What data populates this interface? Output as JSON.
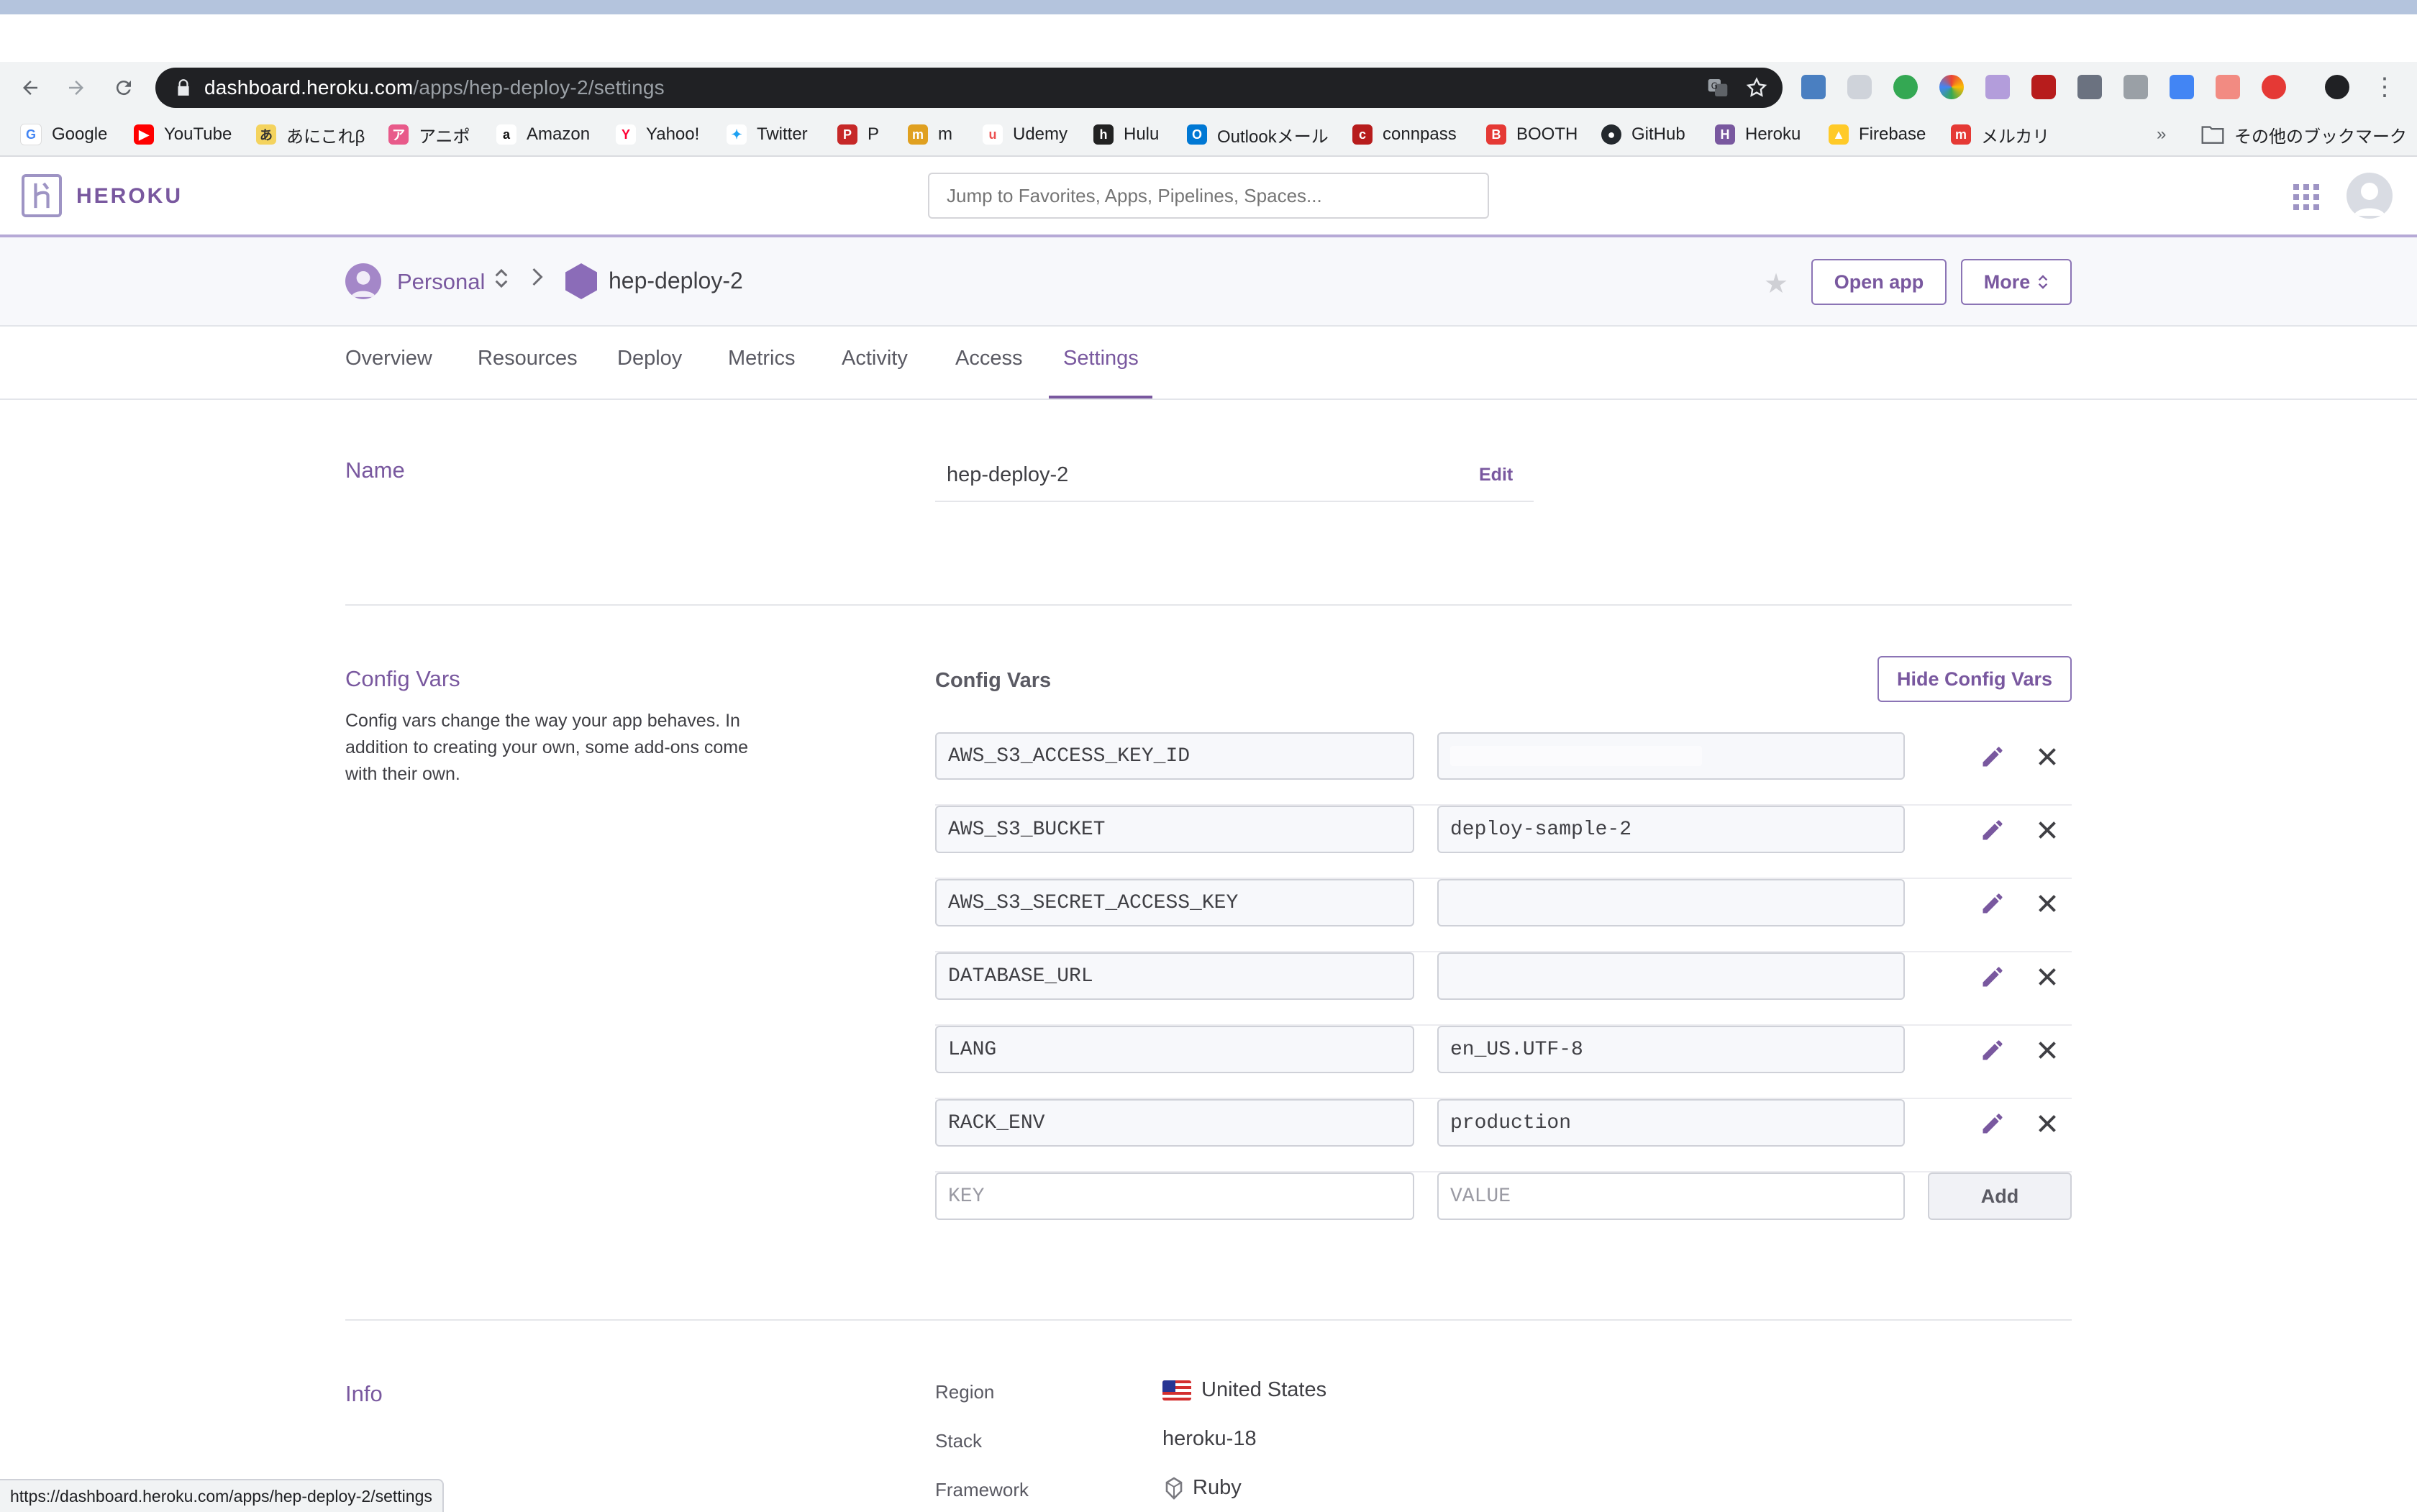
{
  "browser": {
    "url_host": "dashboard.heroku.com",
    "url_path": "/apps/hep-deploy-2/settings",
    "status_url": "https://dashboard.heroku.com/apps/hep-deploy-2/settings",
    "overflow_label": "»",
    "bookmarks": [
      {
        "label": "Google",
        "icon": "google-icon",
        "color": "#4285f4"
      },
      {
        "label": "YouTube",
        "icon": "youtube-icon",
        "color": "#ff0000"
      },
      {
        "label": "あにこれβ",
        "icon": "anikore-icon",
        "color": "#c9a227"
      },
      {
        "label": "アニポ",
        "icon": "anipo-icon",
        "color": "#e85a8a"
      },
      {
        "label": "Amazon",
        "icon": "amazon-icon",
        "color": "#111111"
      },
      {
        "label": "Yahoo!",
        "icon": "yahoo-icon",
        "color": "#ff0033"
      },
      {
        "label": "Twitter",
        "icon": "twitter-icon",
        "color": "#1da1f2"
      },
      {
        "label": "P",
        "icon": "p-icon",
        "color": "#c62828"
      },
      {
        "label": "m",
        "icon": "m-icon",
        "color": "#e0a020"
      },
      {
        "label": "Udemy",
        "icon": "udemy-icon",
        "color": "#ec5252"
      },
      {
        "label": "Hulu",
        "icon": "hulu-icon",
        "color": "#222222"
      },
      {
        "label": "Outlookメール",
        "icon": "outlook-icon",
        "color": "#0078d4"
      },
      {
        "label": "connpass",
        "icon": "connpass-icon",
        "color": "#b71c1c"
      },
      {
        "label": "BOOTH",
        "icon": "booth-icon",
        "color": "#e53935"
      },
      {
        "label": "GitHub",
        "icon": "github-icon",
        "color": "#24292e"
      },
      {
        "label": "Heroku",
        "icon": "heroku-icon",
        "color": "#79589f"
      },
      {
        "label": "Firebase",
        "icon": "firebase-icon",
        "color": "#ffca28"
      },
      {
        "label": "メルカリ",
        "icon": "mercari-icon",
        "color": "#e53935"
      }
    ],
    "other_bookmarks": "その他のブックマーク"
  },
  "heroku": {
    "brand": "HEROKU",
    "search_placeholder": "Jump to Favorites, Apps, Pipelines, Spaces...",
    "accent": "#79589f"
  },
  "appbar": {
    "account": "Personal",
    "app_name": "hep-deploy-2",
    "open_app": "Open app",
    "more": "More"
  },
  "tabs": [
    "Overview",
    "Resources",
    "Deploy",
    "Metrics",
    "Activity",
    "Access",
    "Settings"
  ],
  "active_tab": "Settings",
  "name_section": {
    "title": "Name",
    "value": "hep-deploy-2",
    "edit": "Edit"
  },
  "config_section": {
    "title": "Config Vars",
    "description": "Config vars change the way your app behaves. In addition to creating your own, some add-ons come with their own.",
    "header": "Config Vars",
    "hide_button": "Hide Config Vars",
    "vars": [
      {
        "key": "AWS_S3_ACCESS_KEY_ID",
        "value": ""
      },
      {
        "key": "AWS_S3_BUCKET",
        "value": "deploy-sample-2"
      },
      {
        "key": "AWS_S3_SECRET_ACCESS_KEY",
        "value": ""
      },
      {
        "key": "DATABASE_URL",
        "value": ""
      },
      {
        "key": "LANG",
        "value": "en_US.UTF-8"
      },
      {
        "key": "RACK_ENV",
        "value": "production"
      }
    ],
    "key_placeholder": "KEY",
    "value_placeholder": "VALUE",
    "add_button": "Add"
  },
  "info_section": {
    "title": "Info",
    "rows": [
      {
        "label": "Region",
        "value": "United States"
      },
      {
        "label": "Stack",
        "value": "heroku-18"
      },
      {
        "label": "Framework",
        "value": "Ruby"
      }
    ]
  }
}
